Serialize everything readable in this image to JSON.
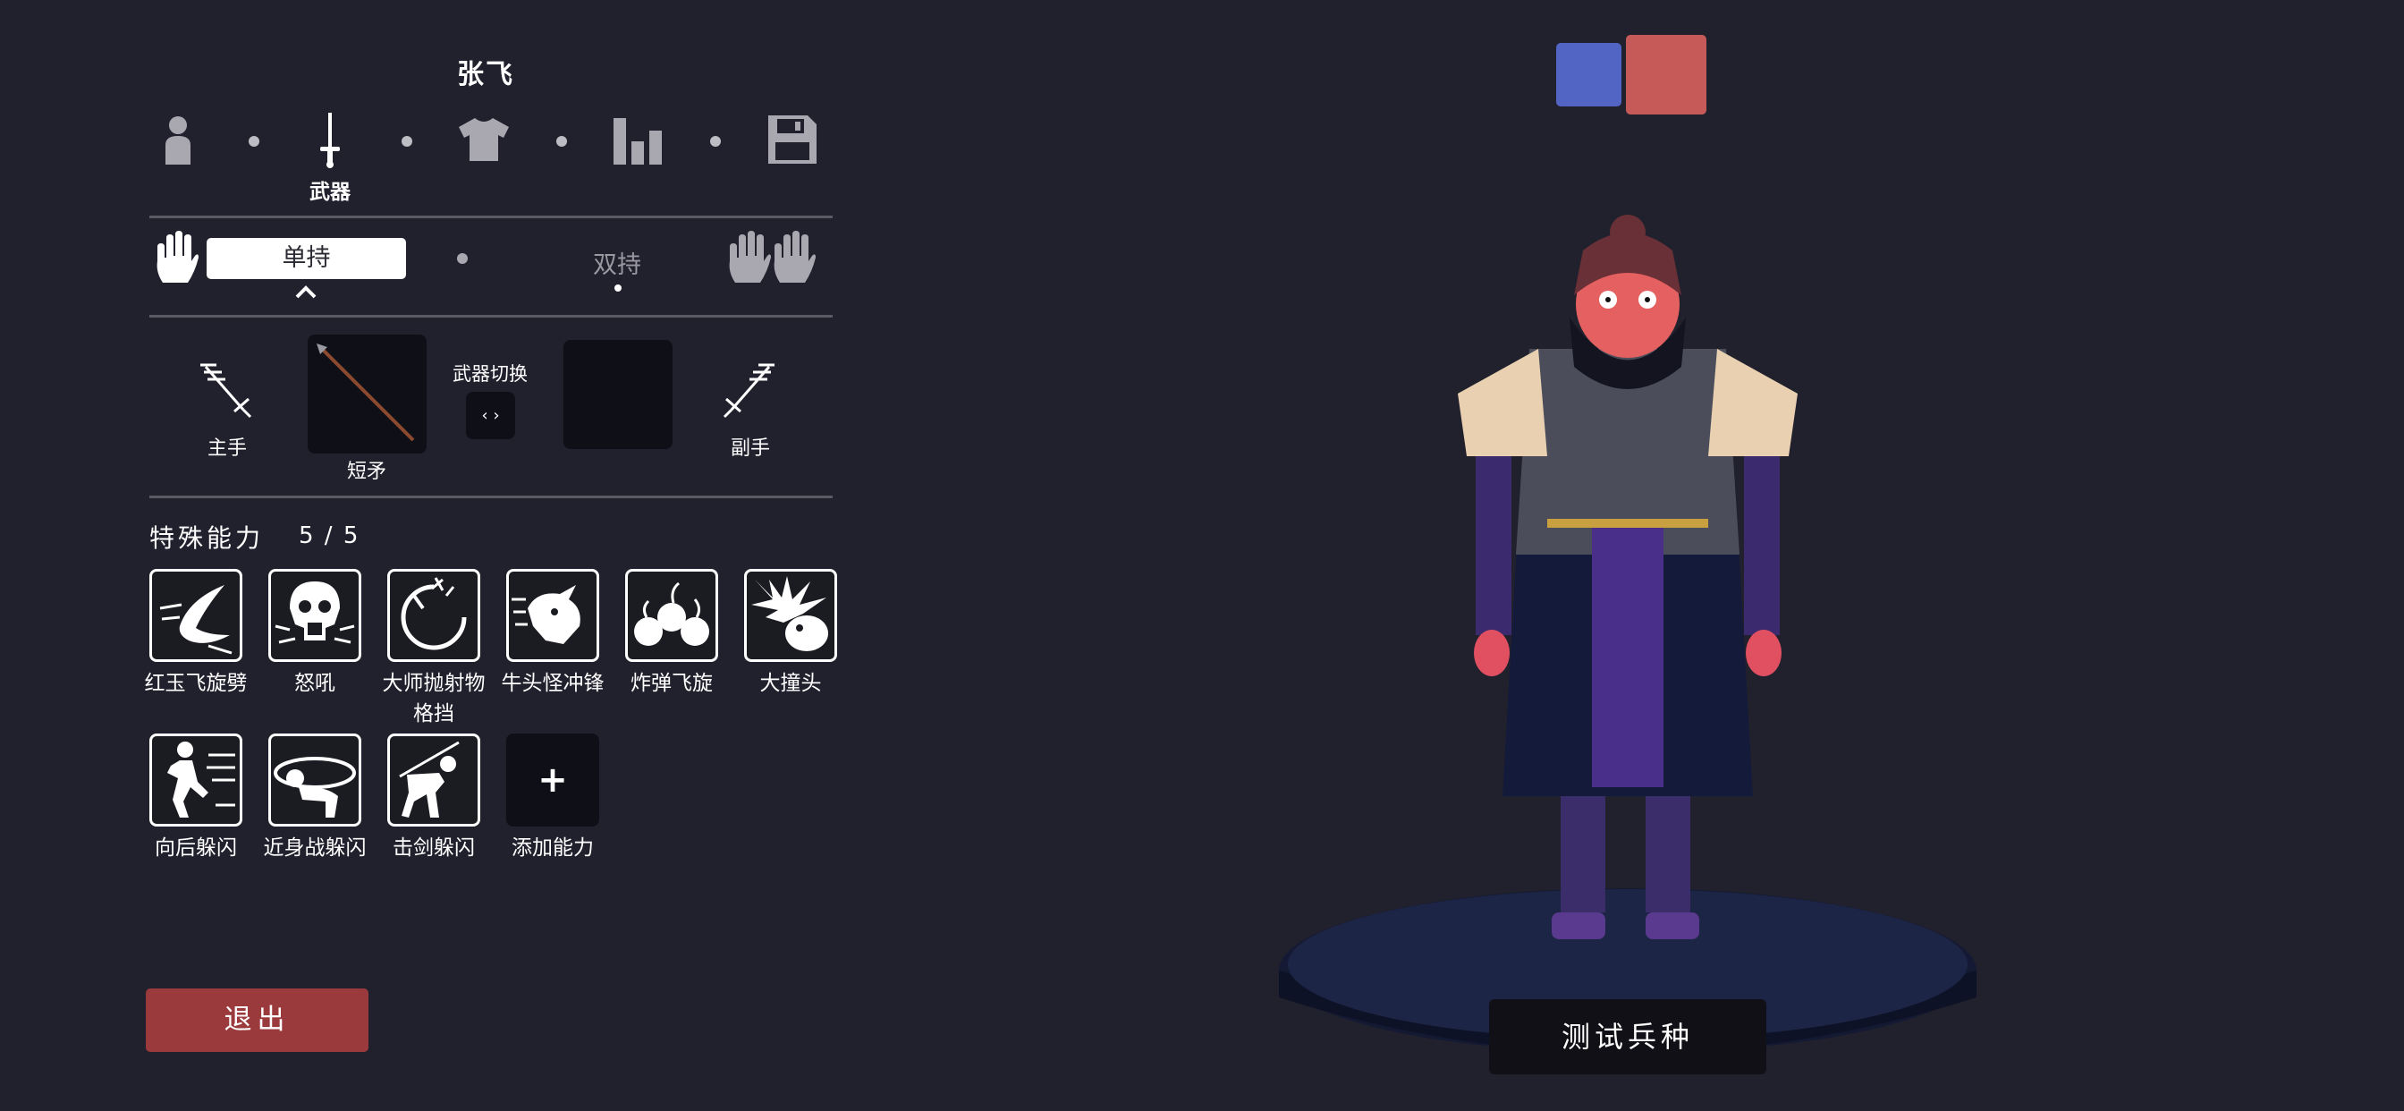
{
  "unit_name": "张飞",
  "steps": {
    "weapon_label": "武器",
    "icons": [
      "person-icon",
      "sword-icon",
      "shirt-icon",
      "bar-chart-icon",
      "save-icon"
    ]
  },
  "grip": {
    "single": "单持",
    "dual": "双持"
  },
  "weapons": {
    "main_hand": "主手",
    "weapon_name": "短矛",
    "switch_label": "武器切换",
    "switch_button": "‹ ›",
    "off_hand": "副手"
  },
  "abilities": {
    "title": "特殊能力",
    "count": "5 / 5",
    "items": [
      {
        "label": "红玉飞旋劈",
        "icon": "spinning-blade-icon"
      },
      {
        "label": "怒吼",
        "icon": "roaring-skull-icon"
      },
      {
        "label": "大师抛射物格挡",
        "icon": "projectile-block-icon"
      },
      {
        "label": "牛头怪冲锋",
        "icon": "minotaur-charge-icon"
      },
      {
        "label": "炸弹飞旋",
        "icon": "bomb-spin-icon"
      },
      {
        "label": "大撞头",
        "icon": "headbutt-icon"
      },
      {
        "label": "向后躲闪",
        "icon": "backstep-dodge-icon"
      },
      {
        "label": "近身战躲闪",
        "icon": "melee-dodge-icon"
      },
      {
        "label": "击剑躲闪",
        "icon": "fencing-dodge-icon"
      }
    ],
    "add_label": "添加能力",
    "add_symbol": "+"
  },
  "buttons": {
    "exit": "退出",
    "test": "测试兵种"
  },
  "colors": {
    "team_blue": "#5365c4",
    "team_red": "#c65a59",
    "exit_red": "#9a3a3c"
  }
}
